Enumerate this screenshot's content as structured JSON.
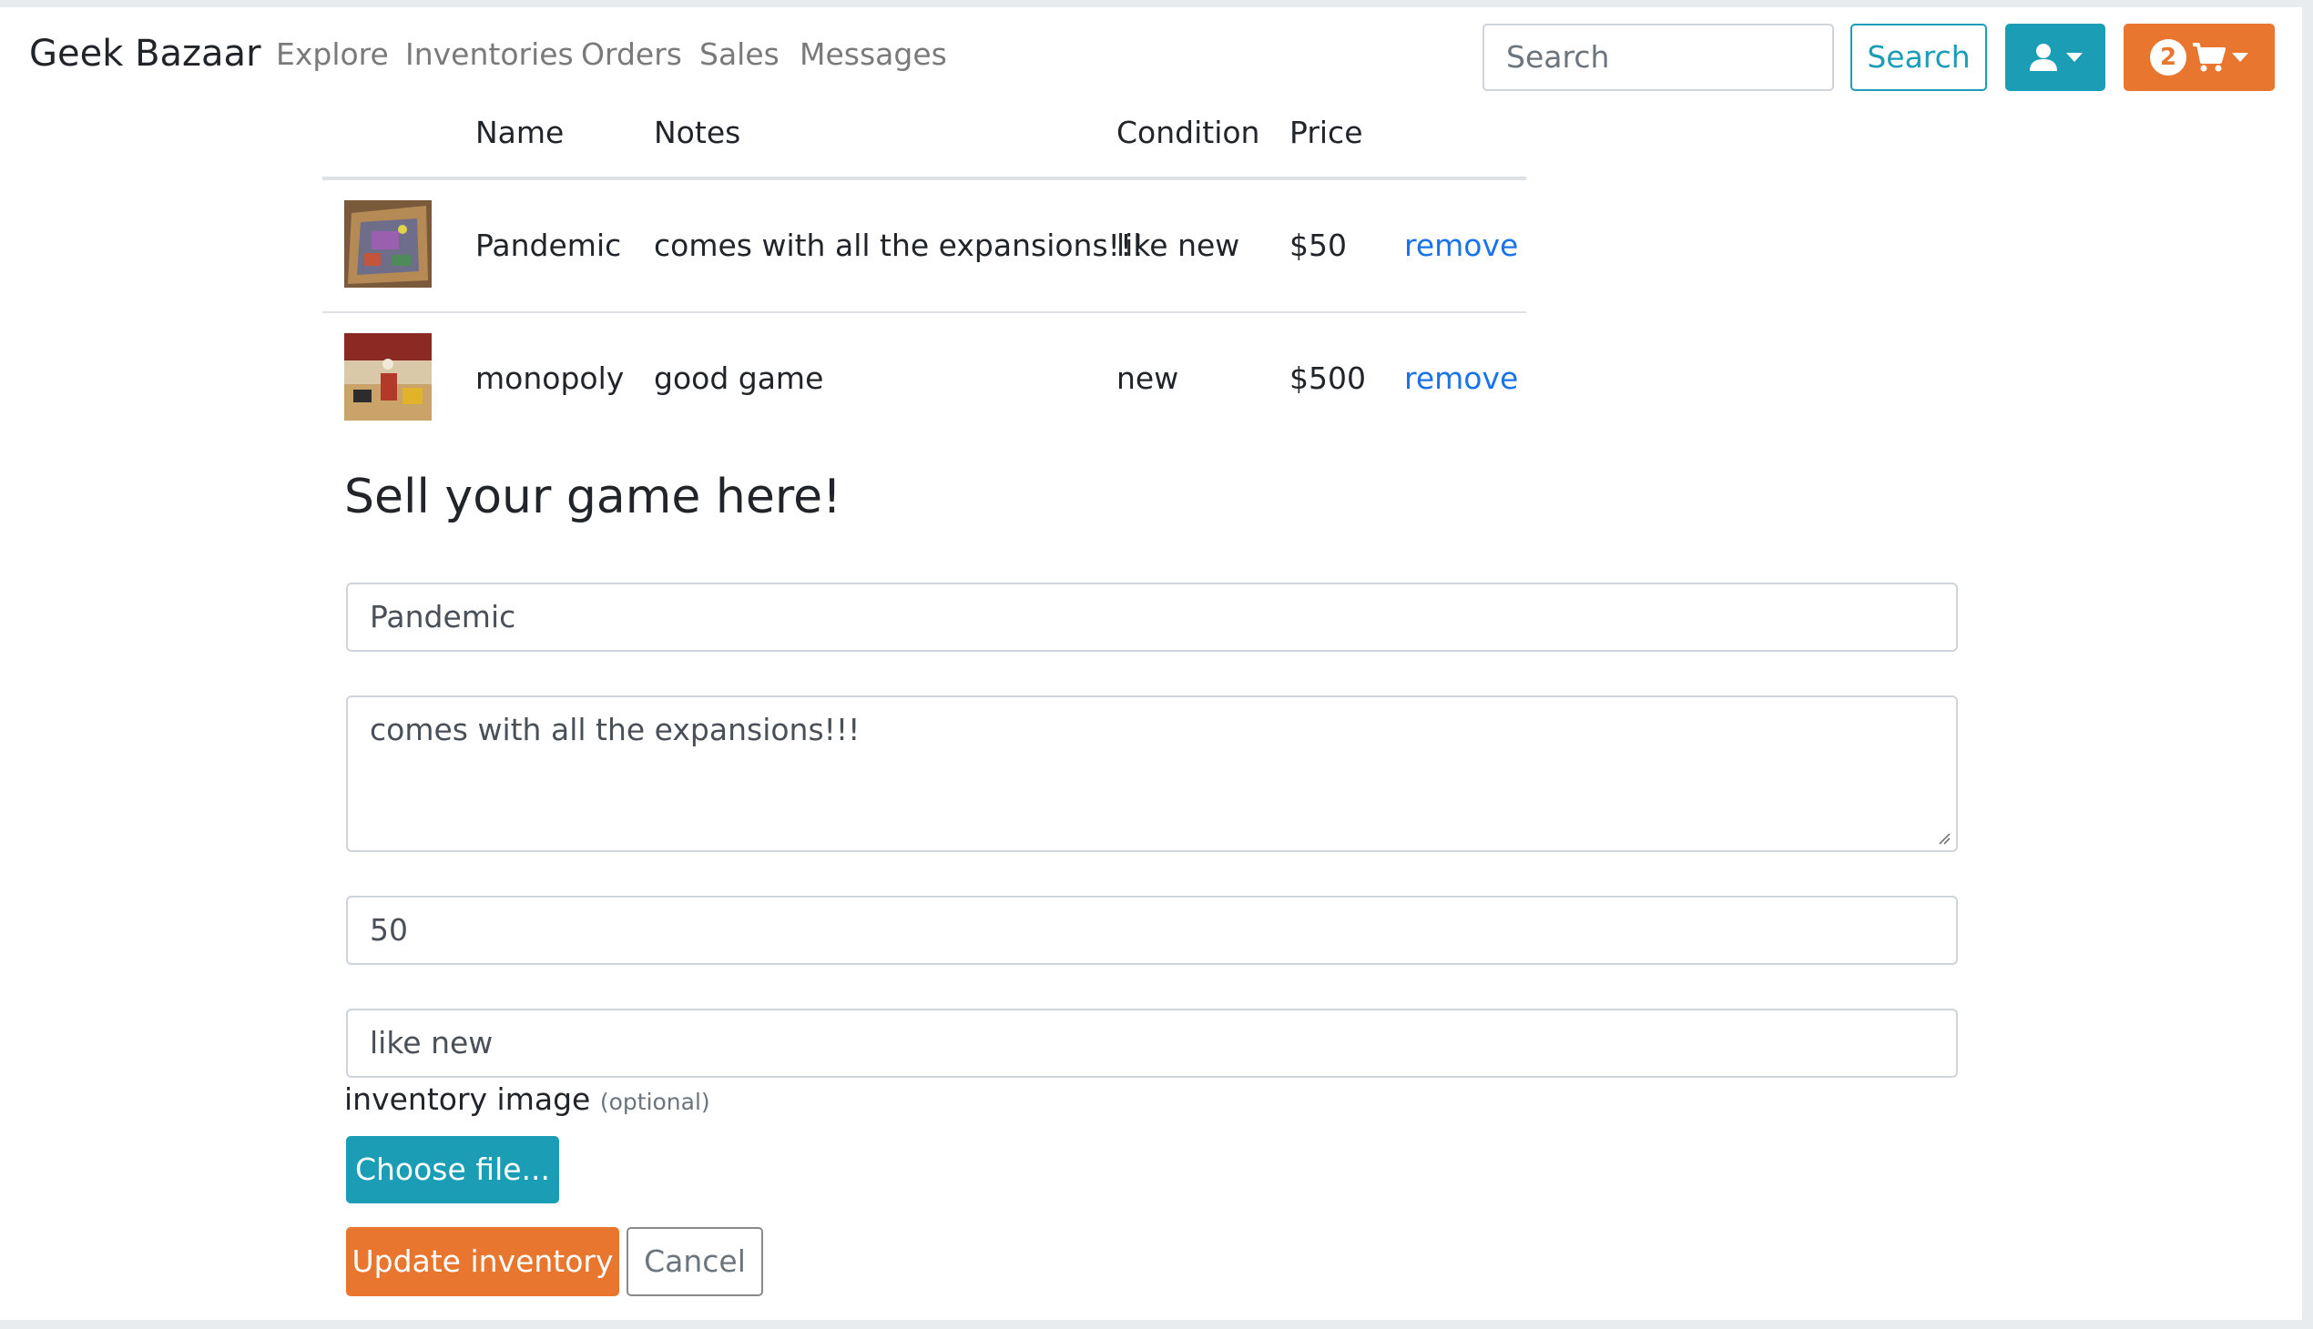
{
  "navbar": {
    "brand": "Geek Bazaar",
    "links": [
      "Explore",
      "Inventories",
      "Orders",
      "Sales",
      "Messages"
    ],
    "search": {
      "placeholder": "Search",
      "button": "Search"
    },
    "cart_count": "2",
    "icons": {
      "user": "user-icon",
      "cart": "cart-icon"
    },
    "colors": {
      "info": "#1b9eb5",
      "warning": "#e8762f",
      "link": "#1a73e8"
    }
  },
  "table": {
    "headers": {
      "name": "Name",
      "notes": "Notes",
      "condition": "Condition",
      "price": "Price"
    },
    "rows": [
      {
        "name": "Pandemic",
        "notes": "comes with all the expansions!!!",
        "condition": "like new",
        "price": "$50",
        "action": "remove"
      },
      {
        "name": "monopoly",
        "notes": "good game",
        "condition": "new",
        "price": "$500",
        "action": "remove"
      }
    ]
  },
  "form": {
    "heading": "Sell your game here!",
    "name_value": "Pandemic",
    "notes_value": "comes with all the expansions!!!",
    "price_value": "50",
    "condition_value": "like new",
    "image_label": "inventory image",
    "image_optional": "(optional)",
    "choose_file": "Choose file...",
    "submit": "Update inventory",
    "cancel": "Cancel"
  }
}
